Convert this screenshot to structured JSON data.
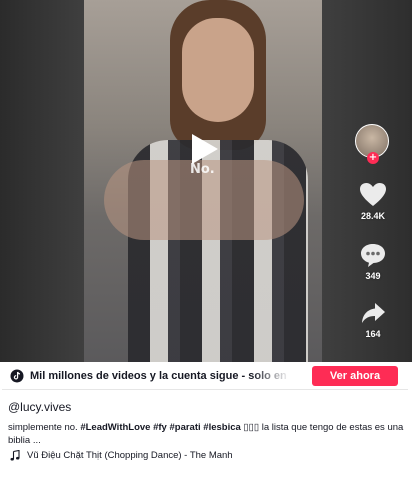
{
  "video": {
    "overlay_text": "No."
  },
  "actions": {
    "likes_count": "28.4K",
    "comments_count": "349",
    "shares_count": "164"
  },
  "banner": {
    "text": "Mil millones de videos y la cuenta sigue - solo en TikTok",
    "cta_label": "Ver ahora"
  },
  "post": {
    "username": "@lucy.vives",
    "description_prefix": "simplemente no. ",
    "tags": [
      "#LeadWithLove",
      "#fy",
      "#parati",
      "#lesbica"
    ],
    "description_suffix": " ▯▯▯ la lista que tengo de estas es una biblia ...",
    "music": "Vũ Điệu Chặt Thịt (Chopping Dance) - The Manh"
  },
  "colors": {
    "accent": "#fe2c55",
    "text": "#161823"
  },
  "icons": [
    "play-icon",
    "follow-plus-icon",
    "heart-icon",
    "comment-icon",
    "share-icon",
    "tiktok-logo-icon",
    "music-note-icon"
  ]
}
